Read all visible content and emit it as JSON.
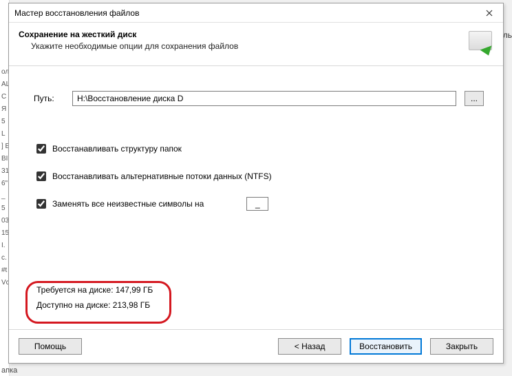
{
  "bg": {
    "right_hint": "итель",
    "list": [
      "ол",
      "AL",
      "C",
      "Я",
      "5",
      "L",
      "] E",
      "BI",
      "31",
      "6\"",
      "_",
      "5",
      "03",
      "15",
      "I.",
      "c.",
      "#t",
      "Vc"
    ],
    "below": "апка"
  },
  "titlebar": {
    "title": "Мастер восстановления файлов"
  },
  "header": {
    "title": "Сохранение на жесткий диск",
    "sub": "Укажите необходимые опции для сохранения файлов"
  },
  "path": {
    "label": "Путь:",
    "value": "H:\\Восстановление диска D",
    "browse": "..."
  },
  "options": {
    "restore_structure": "Восстанавливать структуру папок",
    "restore_ads": "Восстанавливать альтернативные потоки данных (NTFS)",
    "replace_unknown": "Заменять все неизвестные символы на",
    "replace_char": "_"
  },
  "disk": {
    "required": "Требуется на диске: 147,99 ГБ",
    "available": "Доступно на диске: 213,98 ГБ"
  },
  "footer": {
    "help": "Помощь",
    "back": "< Назад",
    "recover": "Восстановить",
    "close": "Закрыть"
  }
}
